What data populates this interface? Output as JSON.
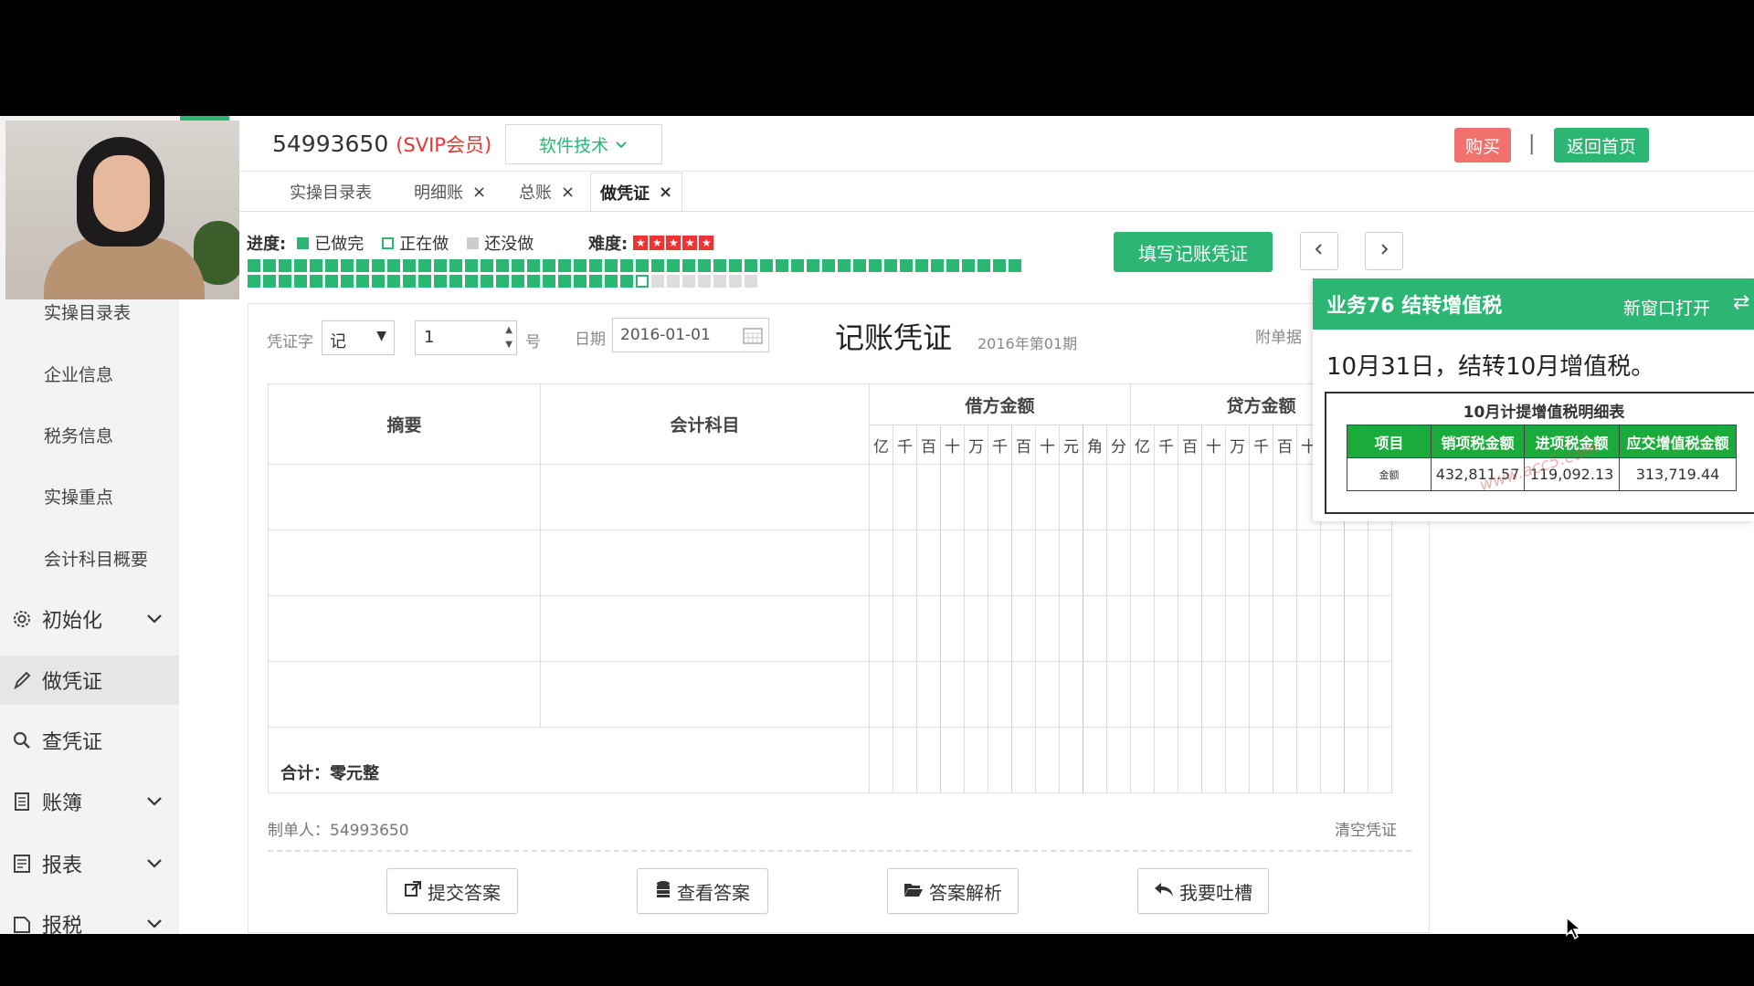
{
  "header": {
    "user_id": "54993650",
    "vip_label": "(SVIP会员)",
    "tech_button": "软件技术",
    "buy_button": "购买",
    "separator": "|",
    "home_button": "返回首页"
  },
  "tabs": [
    {
      "label": "实操目录表",
      "closable": false
    },
    {
      "label": "明细账",
      "closable": true
    },
    {
      "label": "总账",
      "closable": true
    },
    {
      "label": "做凭证",
      "closable": true,
      "active": true
    }
  ],
  "tab_close_glyph": "×",
  "sidebar": {
    "sub_items": [
      {
        "label": "实操目录表"
      },
      {
        "label": "企业信息"
      },
      {
        "label": "税务信息"
      },
      {
        "label": "实操重点"
      },
      {
        "label": "会计科目概要"
      }
    ],
    "main_items": [
      {
        "label": "初始化",
        "icon": "gear-icon",
        "expandable": true
      },
      {
        "label": "做凭证",
        "icon": "pencil-icon",
        "expandable": false,
        "active": true
      },
      {
        "label": "查凭证",
        "icon": "search-icon",
        "expandable": false
      },
      {
        "label": "账簿",
        "icon": "book-icon",
        "expandable": true
      },
      {
        "label": "报表",
        "icon": "report-icon",
        "expandable": true
      },
      {
        "label": "报税",
        "icon": "tax-icon",
        "expandable": true
      }
    ]
  },
  "progress": {
    "label": "进度:",
    "done_label": "已做完",
    "doing_label": "正在做",
    "todo_label": "还没做",
    "difficulty_label": "难度:",
    "difficulty_stars": 5,
    "row1_done": 50,
    "row2_done": 25,
    "row2_doing_index": 25,
    "row2_total": 33
  },
  "actions": {
    "fill_voucher": "填写记账凭证"
  },
  "voucher": {
    "type_label": "凭证字",
    "type_value": "记",
    "number_value": "1",
    "number_suffix": "号",
    "date_label": "日期",
    "date_value": "2016-01-01",
    "title": "记账凭证",
    "period": "2016年第01期",
    "attachment_label": "附单据",
    "col_summary": "摘要",
    "col_account": "会计科目",
    "col_debit": "借方金额",
    "col_credit": "贷方金额",
    "digits": [
      "亿",
      "千",
      "百",
      "十",
      "万",
      "千",
      "百",
      "十",
      "元",
      "角",
      "分"
    ],
    "total_label": "合计：零元整",
    "maker_label": "制单人：54993650",
    "clear_button": "清空凭证"
  },
  "bottom_buttons": [
    {
      "label": "提交答案",
      "icon": "external-link-icon"
    },
    {
      "label": "查看答案",
      "icon": "database-icon"
    },
    {
      "label": "答案解析",
      "icon": "folder-open-icon"
    },
    {
      "label": "我要吐槽",
      "icon": "reply-icon"
    }
  ],
  "task": {
    "title": "业务76 结转增值税",
    "open_new_window": "新窗口打开",
    "description": "10月31日，结转10月增值税。",
    "table_title": "10月计提增值税明细表",
    "headers": [
      "项目",
      "销项税金额",
      "进项税金额",
      "应交增值税金额"
    ],
    "row": [
      "金额",
      "432,811.57",
      "119,092.13",
      "313,719.44"
    ],
    "watermark": "www.acc5.com"
  },
  "colors": {
    "accent": "#2bb673",
    "buy": "#f0716d",
    "vip": "#e33333",
    "table_header": "#1aab3a"
  }
}
